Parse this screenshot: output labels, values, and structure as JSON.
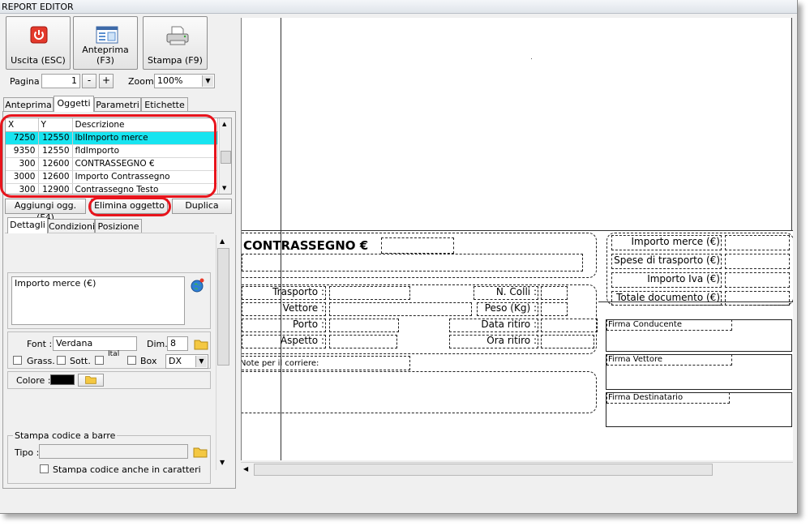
{
  "window": {
    "title": "REPORT EDITOR"
  },
  "toolbar": {
    "exit_label": "Uscita (ESC)",
    "preview_label": "Anteprima (F3)",
    "print_label": "Stampa (F9)"
  },
  "pager": {
    "page_label": "Pagina",
    "page_value": "1",
    "minus_label": "-",
    "plus_label": "+",
    "zoom_label": "Zoom",
    "zoom_value": "100%"
  },
  "top_tabs": [
    "Anteprima",
    "Oggetti",
    "Parametri",
    "Etichette"
  ],
  "objects_table": {
    "headers": [
      "X",
      "Y",
      "Descrizione"
    ],
    "rows": [
      [
        "7250",
        "12550",
        "lblImporto merce"
      ],
      [
        "9350",
        "12550",
        "fldImporto"
      ],
      [
        "300",
        "12600",
        "CONTRASSEGNO €"
      ],
      [
        "3000",
        "12600",
        "Importo Contrassegno"
      ],
      [
        "300",
        "12900",
        "Contrassegno Testo"
      ]
    ]
  },
  "object_buttons": {
    "add_label": "Aggiungi ogg.(F4)",
    "delete_label": "Elimina oggetto",
    "duplicate_label": "Duplica"
  },
  "detail_tabs": [
    "Dettagli",
    "Condizioni",
    "Posizione"
  ],
  "details": {
    "text_value": "Importo merce (€)",
    "font_label": "Font :",
    "font_value": "Verdana",
    "dim_label": "Dim.",
    "dim_value": "8",
    "bold_label": "Grass.",
    "underline_label": "Sott.",
    "italic_label": "Ital",
    "box_label": "Box",
    "align_value": "DX",
    "color_label": "Colore :",
    "color_value": "#000000",
    "barcode_group_label": "Stampa codice a barre",
    "type_label": "Tipo :",
    "type_value": "",
    "barcode_chars_label": "Stampa codice anche in caratteri"
  },
  "canvas": {
    "contrassegno_title": "CONTRASSEGNO €",
    "right_labels": [
      "Importo merce (€)",
      "Spese di trasporto (€)",
      "Importo Iva (€)",
      "Totale documento (€)"
    ],
    "left_labels": [
      "Trasporto :",
      "Vettore :",
      "Porto :",
      "Aspetto :"
    ],
    "mid_labels": [
      "N. Colli :",
      "Peso (Kg) :",
      "Data ritiro :",
      "Ora ritiro :"
    ],
    "notes_label": "Note per il corriere:",
    "signatures": [
      "Firma Conducente",
      "Firma Vettore",
      "Firma Destinatario"
    ]
  },
  "colors": {
    "selected_row": "#17e4f0",
    "highlight": "#e8141c"
  },
  "icons": {
    "exit": "power-icon",
    "preview": "preview-window-icon",
    "print": "printer-icon",
    "globe": "globe-icon",
    "folder": "folder-icon"
  }
}
